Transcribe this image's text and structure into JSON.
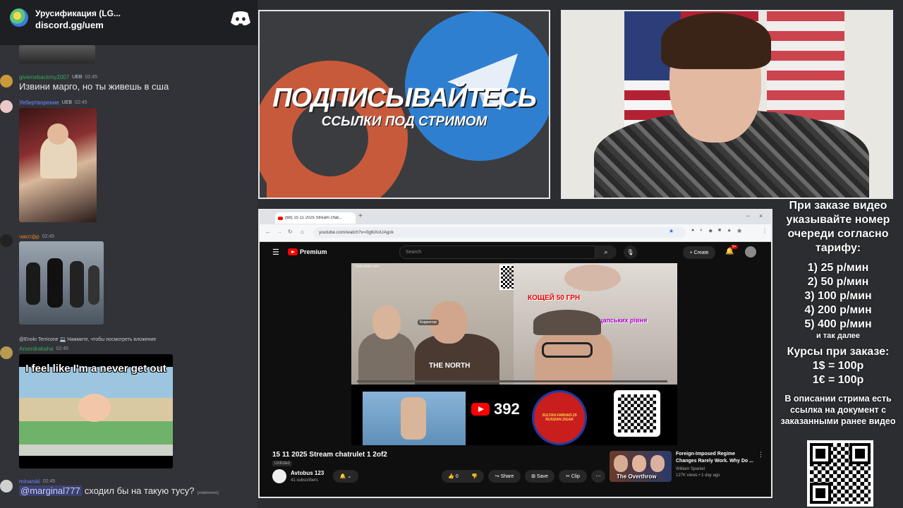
{
  "discord": {
    "server_name": "Урусификация (LG...",
    "invite": "discord.gg/uem",
    "logo_icon": "discord-logo-icon",
    "messages": [
      {
        "username": "givemebackmy2007",
        "badge": "UEB",
        "time": "02:45",
        "text": "Извини марго, но ты живешь в сша",
        "user_color": "#3ba55d"
      },
      {
        "username": "Уебертворение",
        "badge": "UEB",
        "time": "02:45",
        "user_color": "#5865f2"
      },
      {
        "username": "чмотфр",
        "time": "02:45",
        "user_color": "#e67e22"
      },
      {
        "reply": "@Enolo Terricone 💻 Нажмите, чтобы посмотреть вложение",
        "username": "Arsenikakaha",
        "time": "02:45",
        "gif_caption": "I feel like I'm a never get out",
        "user_color": "#3ba55d"
      },
      {
        "username": "minarski",
        "time": "02:45",
        "mention": "@marginal777",
        "text": "сходил бы на такую тусу?",
        "edited": "(изменено)",
        "user_color": "#5865f2"
      }
    ]
  },
  "promo": {
    "line1": "ПОДПИСЫВАЙТЕСЬ",
    "line2": "ССЫЛКИ ПОД СТРИМОМ",
    "colors": {
      "patreon": "#d0573a",
      "telegram": "#2f7fd1"
    }
  },
  "info_panel": {
    "heading": "При заказе видео указывайте номер очереди согласно тарифу:",
    "tariffs": [
      "1) 25 р/мин",
      "2) 50 р/мин",
      "3) 100 р/мин",
      "4) 200 р/мин",
      "5) 400 р/мин"
    ],
    "etc": "и так далее",
    "rates_heading": "Курсы при заказе:",
    "rates": [
      "1$ = 100р",
      "1€ = 100р"
    ],
    "description": "В описании стрима есть ссылка на документ с заказанными ранее видео"
  },
  "browser": {
    "tab_title": "(68) 15 11 2025 Stream chat...",
    "url": "youtube.com/watch?v=0g6iXoUAgck",
    "youtube": {
      "logo": "Premium",
      "search_placeholder": "Search",
      "create_label": "Create",
      "notif_count": "9+",
      "video_title": "15 11 2025 Stream chatrulet 1 2of2",
      "visibility": "Unlisted",
      "channel": "Avtobus 123",
      "subscribers": "41 subscribers",
      "like_count": "0",
      "share_label": "Share",
      "save_label": "Save",
      "clip_label": "Clip",
      "subscriber_count_overlay": "392",
      "overlay_text_1": "КОЩЕЙ 50 ГРН",
      "overlay_text_2": "Два кацапських рiвня",
      "badge_text": "SULTAN FARHAD-29 RUSSIAN ZIGAR",
      "reporter_label": "Корректор",
      "watermark": "Chatrulette.com",
      "shirt_text": "THE NORTH",
      "rec_title": "Foreign-Imposed Regime Changes Rarely Work. Why Do ...",
      "rec_channel": "William Spaniel",
      "rec_meta": "127K views • 1 day ago",
      "rec_thumb_text": "The Overthrow"
    }
  }
}
